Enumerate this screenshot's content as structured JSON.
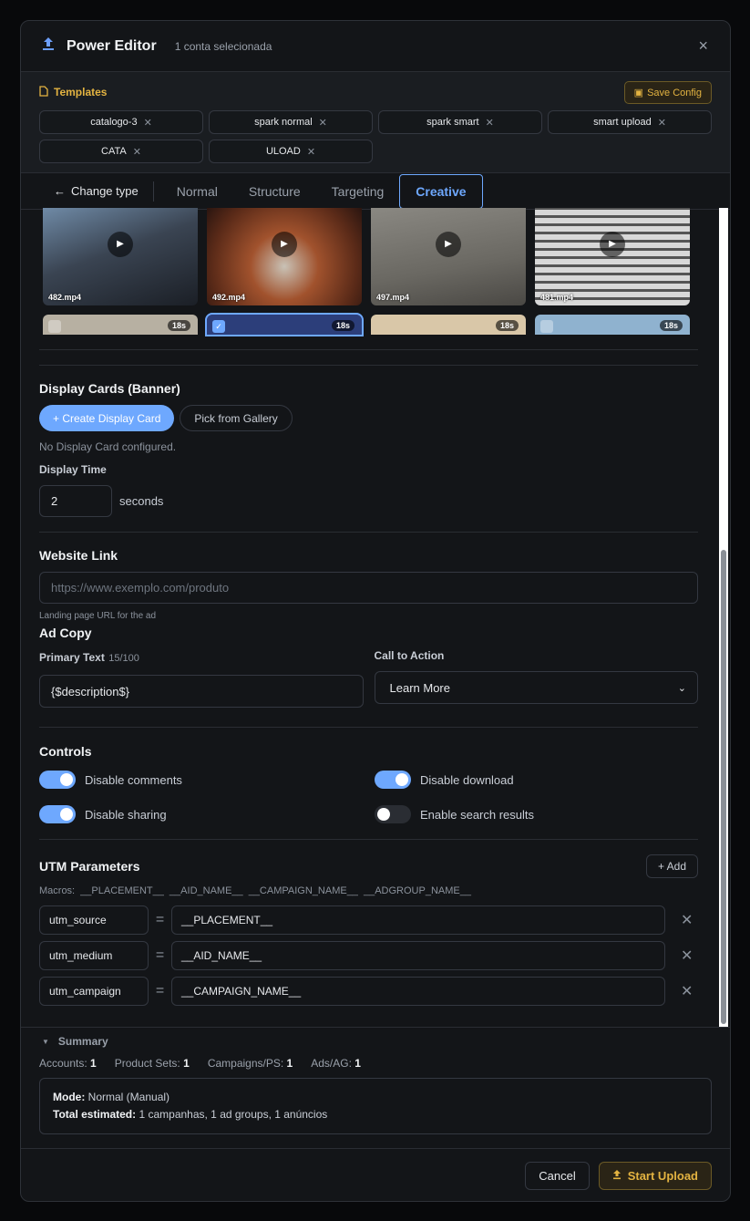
{
  "modal": {
    "title": "Power Editor",
    "subtitle": "1 conta selecionada",
    "close_icon": "×"
  },
  "templates": {
    "label": "Templates",
    "save_label": "Save Config",
    "chips": [
      "catalogo-3",
      "spark normal",
      "spark smart",
      "smart upload",
      "CATA",
      "ULOAD"
    ]
  },
  "tabs": {
    "back_label": "Change type",
    "items": [
      "Normal",
      "Structure",
      "Targeting",
      "Creative"
    ],
    "active": "Creative"
  },
  "videos": {
    "row1": [
      {
        "name": "482.mp4"
      },
      {
        "name": "492.mp4"
      },
      {
        "name": "497.mp4"
      },
      {
        "name": "481.mp4"
      }
    ],
    "row2": [
      {
        "duration": "18s",
        "selected": false
      },
      {
        "duration": "18s",
        "selected": true
      },
      {
        "duration": "18s",
        "selected": false
      },
      {
        "duration": "18s",
        "selected": false
      }
    ]
  },
  "display_cards": {
    "title": "Display Cards (Banner)",
    "create_label": "+ Create Display Card",
    "pick_label": "Pick from Gallery",
    "empty_text": "No Display Card configured.",
    "time_label": "Display Time",
    "time_value": "2",
    "time_unit": "seconds"
  },
  "website": {
    "title": "Website Link",
    "placeholder": "https://www.exemplo.com/produto",
    "help": "Landing page URL for the ad"
  },
  "ad_copy": {
    "title": "Ad Copy",
    "primary_label": "Primary Text",
    "primary_count": "15/100",
    "primary_value": "{$description$}",
    "cta_label": "Call to Action",
    "cta_value": "Learn More"
  },
  "controls": {
    "title": "Controls",
    "items": [
      {
        "label": "Disable comments",
        "on": true
      },
      {
        "label": "Disable download",
        "on": true
      },
      {
        "label": "Disable sharing",
        "on": true
      },
      {
        "label": "Enable search results",
        "on": false
      }
    ]
  },
  "utm": {
    "title": "UTM Parameters",
    "add_label": "+ Add",
    "macros": "Macros: __PLACEMENT__ __AID_NAME__ __CAMPAIGN_NAME__ __ADGROUP_NAME__",
    "rows": [
      {
        "key": "utm_source",
        "value": "__PLACEMENT__"
      },
      {
        "key": "utm_medium",
        "value": "__AID_NAME__"
      },
      {
        "key": "utm_campaign",
        "value": "__CAMPAIGN_NAME__"
      }
    ]
  },
  "summary": {
    "title": "Summary",
    "accounts_label": "Accounts:",
    "accounts": "1",
    "product_sets_label": "Product Sets:",
    "product_sets": "1",
    "campaigns_label": "Campaigns/PS:",
    "campaigns": "1",
    "ads_label": "Ads/AG:",
    "ads": "1",
    "mode_label": "Mode:",
    "mode_value": "Normal (Manual)",
    "total_label": "Total estimated:",
    "total_value": "1 campanhas, 1 ad groups, 1 anúncios"
  },
  "footer": {
    "cancel_label": "Cancel",
    "start_label": "Start Upload"
  },
  "colors": {
    "accent": "#6ea8fe",
    "gold": "#e3b341",
    "bg": "#131518"
  }
}
